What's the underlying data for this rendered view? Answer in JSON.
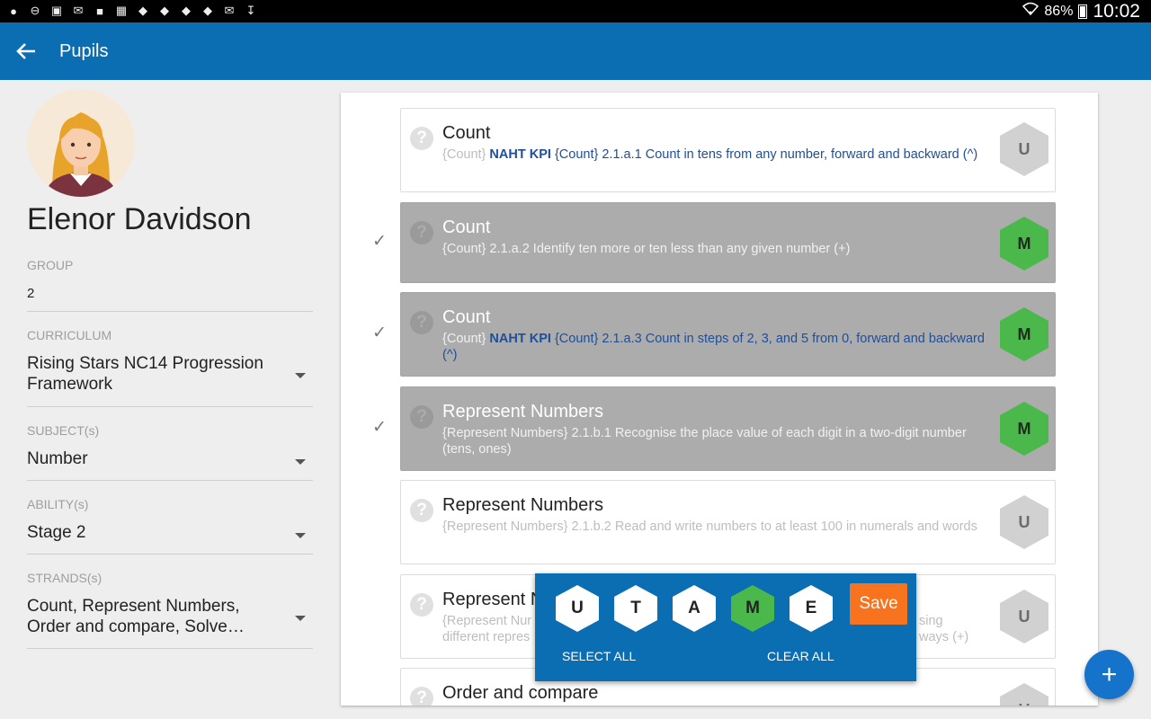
{
  "status_bar": {
    "battery": "86%",
    "time": "10:02"
  },
  "app_bar": {
    "title": "Pupils"
  },
  "pupil": {
    "name": "Elenor Davidson",
    "fields": [
      {
        "label": "GROUP",
        "value": "2",
        "dropdown": false
      },
      {
        "label": "CURRICULUM",
        "value": "Rising Stars NC14 Progression Framework",
        "dropdown": true
      },
      {
        "label": "SUBJECT(s)",
        "value": "Number",
        "dropdown": true
      },
      {
        "label": "ABILITY(s)",
        "value": "Stage 2",
        "dropdown": true
      },
      {
        "label": "STRANDS(s)",
        "value": "Count, Represent Numbers, Order and compare, Solve…",
        "dropdown": true
      }
    ]
  },
  "objectives": [
    {
      "title": "Count",
      "prefix": "{Count}",
      "kpi": "NAHT KPI",
      "kpi_tag": "{Count}",
      "text": "2.1.a.1 Count in tens from any number, forward and backward (^)",
      "grade": "U",
      "checked": false
    },
    {
      "title": "Count",
      "prefix": "{Count}",
      "kpi": "",
      "kpi_tag": "",
      "text": "2.1.a.2 Identify ten more or ten less than any given number (+)",
      "grade": "M",
      "checked": true
    },
    {
      "title": "Count",
      "prefix": "{Count}",
      "kpi": "NAHT KPI",
      "kpi_tag": "{Count}",
      "text": "2.1.a.3 Count in steps of 2, 3, and 5 from 0, forward and backward (^)",
      "grade": "M",
      "checked": true
    },
    {
      "title": "Represent Numbers",
      "prefix": "{Represent Numbers}",
      "kpi": "",
      "kpi_tag": "",
      "text": "2.1.b.1 Recognise the place value of each digit in a two-digit number (tens, ones)",
      "grade": "M",
      "checked": true
    },
    {
      "title": "Represent Numbers",
      "prefix": "{Represent Numbers}",
      "kpi": "",
      "kpi_tag": "",
      "text": "2.1.b.2 Read and write numbers to at least 100 in numerals and words",
      "grade": "U",
      "checked": false
    },
    {
      "title": "Represent N",
      "prefix": "{Represent Nur",
      "kpi": "",
      "kpi_tag": "",
      "text": "",
      "text_line2": "different repres",
      "tail1": "sing",
      "tail2": "ways (+)",
      "grade": "U",
      "checked": false
    },
    {
      "title": "Order and compare",
      "prefix": "",
      "kpi": "",
      "kpi_tag": "",
      "text": "",
      "grade": "U",
      "checked": false
    }
  ],
  "grade_popup": {
    "grades": [
      "U",
      "T",
      "A",
      "M",
      "E"
    ],
    "selected": "M",
    "save_label": "Save",
    "select_all_label": "SELECT ALL",
    "clear_all_label": "CLEAR ALL"
  },
  "fab_label": "+",
  "colors": {
    "primary": "#0b6db2",
    "mastered": "#4bb84b",
    "save": "#f7731e"
  }
}
